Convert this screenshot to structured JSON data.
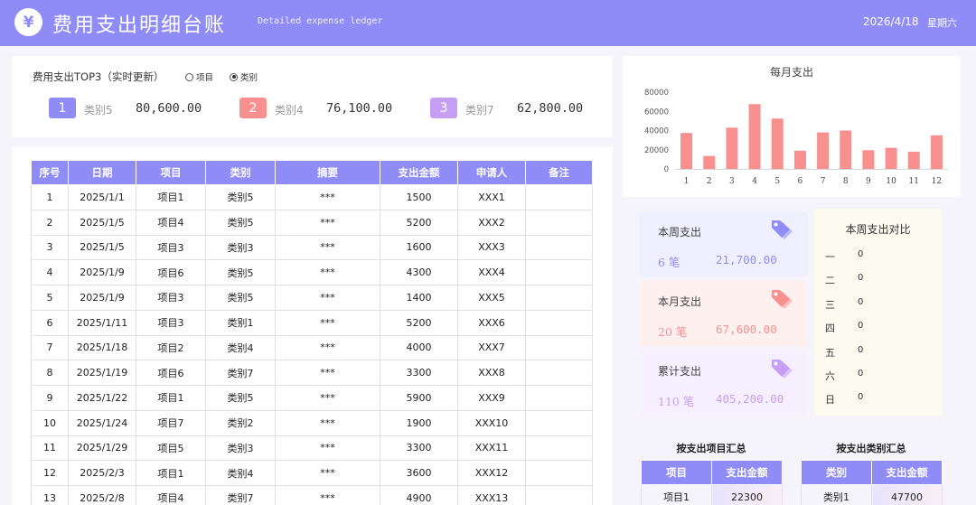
{
  "header": {
    "logo_symbol": "¥",
    "title": "费用支出明细台账",
    "subtitle": "Detailed expense ledger",
    "date": "2026/4/18",
    "weekday": "星期六",
    "color": "#8f8cf7"
  },
  "top3": {
    "label": "费用支出TOP3（实时更新）",
    "options": [
      {
        "label": "项目",
        "selected": false
      },
      {
        "label": "类别",
        "selected": true
      }
    ],
    "ranks": [
      {
        "rank": "1",
        "name": "类别5",
        "amount": "80,600.00",
        "color": "#8f8cf7"
      },
      {
        "rank": "2",
        "name": "类别4",
        "amount": "76,100.00",
        "color": "#f7908f"
      },
      {
        "rank": "3",
        "name": "类别7",
        "amount": "62,800.00",
        "color": "#c69ff5"
      }
    ]
  },
  "ledger": {
    "columns": [
      "序号",
      "日期",
      "项目",
      "类别",
      "摘要",
      "支出金额",
      "申请人",
      "备注"
    ],
    "rows": [
      [
        "1",
        "2025/1/1",
        "项目1",
        "类别5",
        "***",
        "1500",
        "XXX1",
        ""
      ],
      [
        "2",
        "2025/1/5",
        "项目4",
        "类别5",
        "***",
        "5200",
        "XXX2",
        ""
      ],
      [
        "3",
        "2025/1/5",
        "项目3",
        "类别3",
        "***",
        "1600",
        "XXX3",
        ""
      ],
      [
        "4",
        "2025/1/9",
        "项目6",
        "类别5",
        "***",
        "4300",
        "XXX4",
        ""
      ],
      [
        "5",
        "2025/1/9",
        "项目3",
        "类别5",
        "***",
        "1400",
        "XXX5",
        ""
      ],
      [
        "6",
        "2025/1/11",
        "项目3",
        "类别1",
        "***",
        "5200",
        "XXX6",
        ""
      ],
      [
        "7",
        "2025/1/18",
        "项目2",
        "类别4",
        "***",
        "4000",
        "XXX7",
        ""
      ],
      [
        "8",
        "2025/1/19",
        "项目6",
        "类别7",
        "***",
        "3300",
        "XXX8",
        ""
      ],
      [
        "9",
        "2025/1/22",
        "项目1",
        "类别5",
        "***",
        "5900",
        "XXX9",
        ""
      ],
      [
        "10",
        "2025/1/24",
        "项目7",
        "类别2",
        "***",
        "1900",
        "XXX10",
        ""
      ],
      [
        "11",
        "2025/1/29",
        "项目5",
        "类别3",
        "***",
        "3300",
        "XXX11",
        ""
      ],
      [
        "12",
        "2025/2/3",
        "项目1",
        "类别4",
        "***",
        "3600",
        "XXX12",
        ""
      ],
      [
        "13",
        "2025/2/8",
        "项目4",
        "类别7",
        "***",
        "4900",
        "XXX13",
        ""
      ]
    ]
  },
  "chart_data": {
    "type": "bar",
    "title": "每月支出",
    "categories": [
      "1",
      "2",
      "3",
      "4",
      "5",
      "6",
      "7",
      "8",
      "9",
      "10",
      "11",
      "12"
    ],
    "values": [
      37500,
      13500,
      43000,
      67500,
      52500,
      19000,
      38000,
      40000,
      19500,
      22000,
      18000,
      35000
    ],
    "yticks": [
      "0",
      "20000",
      "40000",
      "60000",
      "80000"
    ],
    "ylim": [
      0,
      80000
    ],
    "grid": false,
    "bar_color": "#f7908f"
  },
  "cards": [
    {
      "label": "本周支出",
      "count": "6 笔",
      "amount": "21,700.00",
      "bg": "#efefff",
      "fg": "#8f8cf7",
      "icon": "price-tag-icon"
    },
    {
      "label": "本月支出",
      "count": "20 笔",
      "amount": "67,600.00",
      "bg": "#fff0f0",
      "fg": "#f7908f",
      "icon": "price-tag-icon"
    },
    {
      "label": "累计支出",
      "count": "110 笔",
      "amount": "405,200.00",
      "bg": "#f6efff",
      "fg": "#c69ff5",
      "icon": "price-tag-icon"
    }
  ],
  "week_compare": {
    "title": "本周支出对比",
    "days": [
      {
        "day": "一",
        "value": "0"
      },
      {
        "day": "二",
        "value": "0"
      },
      {
        "day": "三",
        "value": "0"
      },
      {
        "day": "四",
        "value": "0"
      },
      {
        "day": "五",
        "value": "0"
      },
      {
        "day": "六",
        "value": "0"
      },
      {
        "day": "日",
        "value": "0"
      }
    ]
  },
  "summary_project": {
    "title": "按支出项目汇总",
    "columns": [
      "项目",
      "支出金额"
    ],
    "rows": [
      [
        "项目1",
        "22300"
      ]
    ]
  },
  "summary_category": {
    "title": "按支出类别汇总",
    "columns": [
      "类别",
      "支出金额"
    ],
    "rows": [
      [
        "类别1",
        "47700"
      ]
    ]
  }
}
